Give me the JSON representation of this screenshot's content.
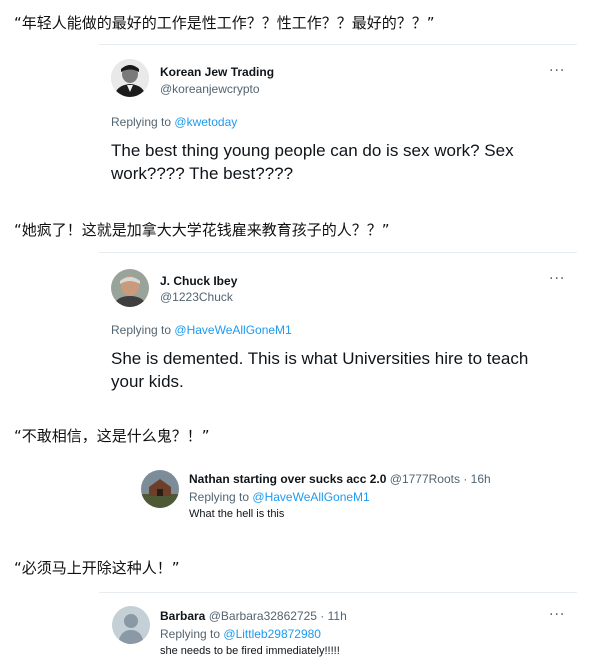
{
  "sections": [
    {
      "quote": "“年轻人能做的最好的工作是性工作？？性工作？？最好的？？”",
      "tweet": {
        "name": "Korean Jew Trading",
        "handle": "@koreanjewcrypto",
        "replying_prefix": "Replying to",
        "replying_to": "@kwetoday",
        "text": "The best thing young people can do is sex work? Sex work???? The best????"
      }
    },
    {
      "quote": "“她疯了！这就是加拿大大学花钱雇来教育孩子的人？？”",
      "tweet": {
        "name": "J. Chuck Ibey",
        "handle": "@1223Chuck",
        "replying_prefix": "Replying to",
        "replying_to": "@HaveWeAllGoneM1",
        "text": "She is demented.  This is what Universities hire to teach your kids."
      }
    },
    {
      "quote": "“不敢相信，这是什么鬼？！”",
      "tweet": {
        "name": "Nathan starting over sucks acc 2.0",
        "handle_time": "@1777Roots · 16h",
        "replying_prefix": "Replying to",
        "replying_to": "@HaveWeAllGoneM1",
        "text": "What the hell is this"
      }
    },
    {
      "quote": "“必须马上开除这种人！”",
      "tweet": {
        "name": "Barbara",
        "handle_time": "@Barbara32862725 · 11h",
        "replying_prefix": "Replying to",
        "replying_to": "@Littleb29872980",
        "text": "she needs to be fired immediately!!!!!"
      }
    }
  ],
  "icons": {
    "more": "more-horizontal-icon"
  }
}
